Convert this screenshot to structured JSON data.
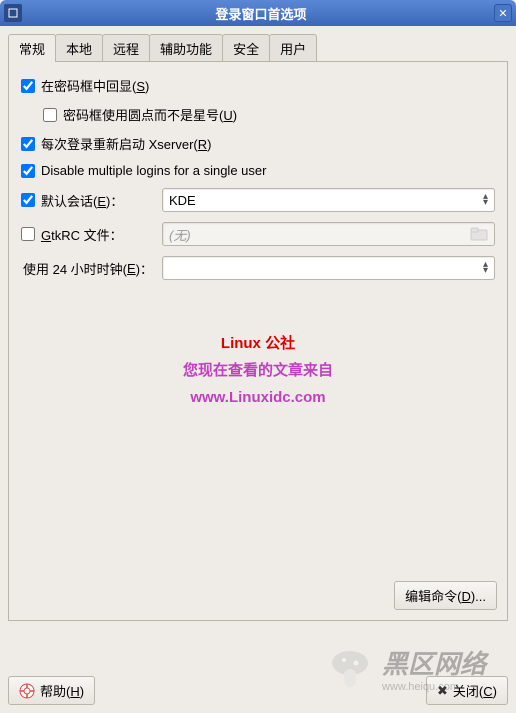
{
  "window": {
    "title": "登录窗口首选项"
  },
  "tabs": {
    "general": "常规",
    "local": "本地",
    "remote": "远程",
    "accessibility": "辅助功能",
    "security": "安全",
    "users": "用户"
  },
  "options": {
    "echo_password": "在密码框中回显(",
    "echo_password_key": "S",
    "echo_password_end": ")",
    "dots_not_stars": "密码框使用圆点而不是星号(",
    "dots_not_stars_key": "U",
    "dots_not_stars_end": ")",
    "restart_xserver": "每次登录重新启动 Xserver(",
    "restart_xserver_key": "R",
    "restart_xserver_end": ")",
    "disable_multiple": "Disable multiple logins for a single user"
  },
  "form": {
    "default_session_label": "默认会话(",
    "default_session_key": "E",
    "default_session_end": ")：",
    "default_session_value": "KDE",
    "gtkrc_label_pre": "",
    "gtkrc_key": "G",
    "gtkrc_label": "tkRC 文件：",
    "gtkrc_placeholder": "(无)",
    "clock_label": "使用 24 小时时钟(",
    "clock_key": "E",
    "clock_end": ")：",
    "clock_value": ""
  },
  "watermark": {
    "line1": "Linux 公社",
    "line2": "您现在查看的文章来自",
    "line3": "www.Linuxidc.com"
  },
  "buttons": {
    "edit_commands": "编辑命令(",
    "edit_commands_key": "D",
    "edit_commands_end": ")...",
    "help": "帮助(",
    "help_key": "H",
    "help_end": ")",
    "close": "关闭(",
    "close_key": "C",
    "close_end": ")"
  },
  "logo": {
    "text": "黑区网络",
    "sub": "www.heiqu.com"
  }
}
